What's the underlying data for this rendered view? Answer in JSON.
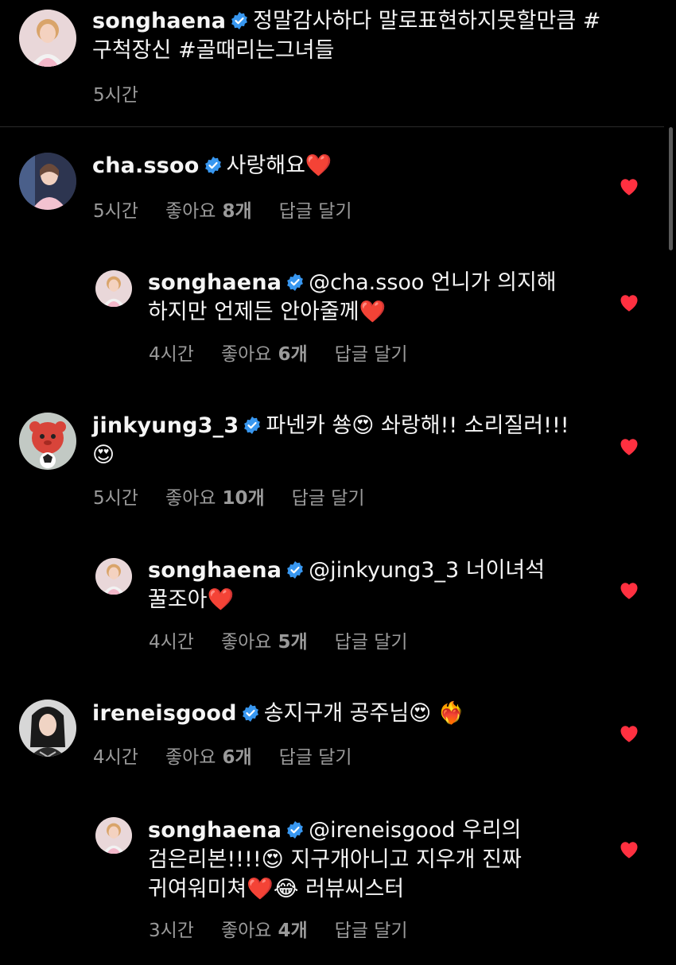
{
  "caption": {
    "username": "songhaena",
    "text": "정말감사하다 말로표현하지못할만큼 #구척장신 #골때리는그녀들",
    "time": "5시간"
  },
  "comments": [
    {
      "username": "cha.ssoo",
      "text": "사랑해요❤️",
      "time": "5시간",
      "likes_label": "좋아요",
      "likes_count": "8개",
      "reply_label": "답글 달기"
    },
    {
      "username": "songhaena",
      "text": "@cha.ssoo 언니가 의지해 하지만 언제든 안아줄께❤️",
      "time": "4시간",
      "likes_label": "좋아요",
      "likes_count": "6개",
      "reply_label": "답글 달기"
    },
    {
      "username": "jinkyung3_3",
      "text": "파넨카 쑝😍 솨랑해!! 소리질러!!!😍",
      "time": "5시간",
      "likes_label": "좋아요",
      "likes_count": "10개",
      "reply_label": "답글 달기"
    },
    {
      "username": "songhaena",
      "text": "@jinkyung3_3 너이녀석 꿀조아❤️",
      "time": "4시간",
      "likes_label": "좋아요",
      "likes_count": "5개",
      "reply_label": "답글 달기"
    },
    {
      "username": "ireneisgood",
      "text": "송지구개 공주님😍 ❤️‍🔥",
      "time": "4시간",
      "likes_label": "좋아요",
      "likes_count": "6개",
      "reply_label": "답글 달기"
    },
    {
      "username": "songhaena",
      "text": "@ireneisgood 우리의 검은리본!!!!😍 지구개아니고 지우개 진짜 귀여워미쳐❤️😂 러뷰씨스터",
      "time": "3시간",
      "likes_label": "좋아요",
      "likes_count": "4개",
      "reply_label": "답글 달기"
    }
  ],
  "colors": {
    "background": "#000000",
    "verified": "#3897f0",
    "heart": "#ff3040",
    "meta_text": "#9a9a9a"
  },
  "icons": [
    "verified-badge-icon",
    "heart-icon"
  ]
}
